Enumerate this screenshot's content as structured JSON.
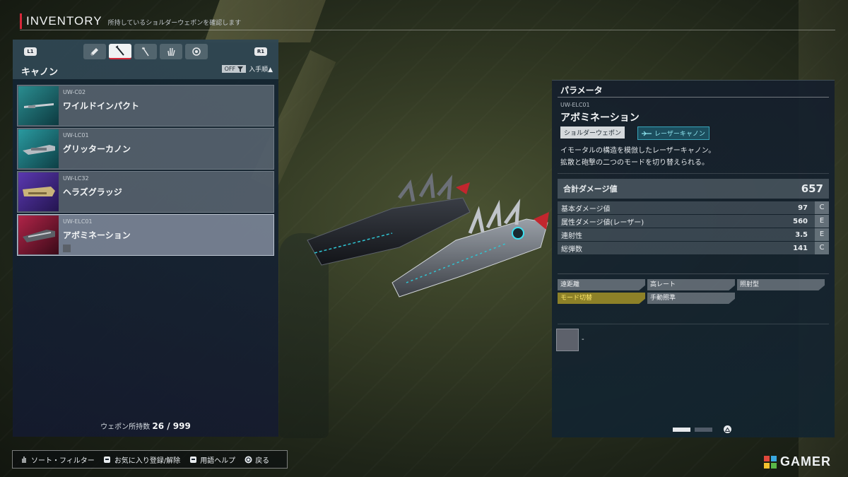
{
  "header": {
    "title": "INVENTORY",
    "subtitle": "所持しているショルダーウェポンを確認します"
  },
  "left_panel": {
    "l1": "L1",
    "r1": "R1",
    "category_tabs": [
      {
        "icon": "shield-icon"
      },
      {
        "icon": "shoulder-weapon-icon",
        "active": true
      },
      {
        "icon": "blade-icon"
      },
      {
        "icon": "hand-icon"
      },
      {
        "icon": "module-icon"
      }
    ],
    "category_label": "キャノン",
    "filter_state": "OFF",
    "sort_label": "入手順▲",
    "weapons": [
      {
        "code": "UW-C02",
        "name": "ワイルドインパクト",
        "thumb_color": "#1f6c70"
      },
      {
        "code": "UW-LC01",
        "name": "グリッターカノン",
        "thumb_color": "#1f7a80"
      },
      {
        "code": "UW-LC32",
        "name": "ヘラズグラッジ",
        "thumb_color": "#3f2a8a"
      },
      {
        "code": "UW-ELC01",
        "name": "アボミネーション",
        "thumb_color": "#8a1f3a",
        "selected": true
      }
    ],
    "count_label": "ウェポン所持数",
    "count_value": "26 / 999"
  },
  "right_panel": {
    "title": "パラメータ",
    "code": "UW-ELC01",
    "name": "アボミネーション",
    "tag_type": "ショルダーウェポン",
    "tag_subtype": "レーザーキャノン",
    "desc_line1": "イモータルの構造を模倣したレーザーキャノン。",
    "desc_line2": "拡散と砲撃の二つのモードを切り替えられる。",
    "total_label": "合計ダメージ値",
    "total_value": "657",
    "stats": [
      {
        "label": "基本ダメージ値",
        "value": "97",
        "grade": "C"
      },
      {
        "label": "属性ダメージ値(レーザー)",
        "value": "560",
        "grade": "E"
      },
      {
        "label": "連射性",
        "value": "3.5",
        "grade": "E"
      },
      {
        "label": "総弾数",
        "value": "141",
        "grade": "C"
      }
    ],
    "traits": [
      {
        "label": "遠距離",
        "highlight": false
      },
      {
        "label": "高レート",
        "highlight": false
      },
      {
        "label": "照射型",
        "highlight": false
      },
      {
        "label": "モード切替",
        "highlight": true
      },
      {
        "label": "手動照準",
        "highlight": false
      }
    ],
    "slot_text": "-",
    "accent_color": "#38a6bb"
  },
  "help": {
    "sort_filter": "ソート・フィルター",
    "favorite": "お気に入り登録/解除",
    "glossary": "用語ヘルプ",
    "back": "戻る"
  },
  "watermark": "GAMER"
}
